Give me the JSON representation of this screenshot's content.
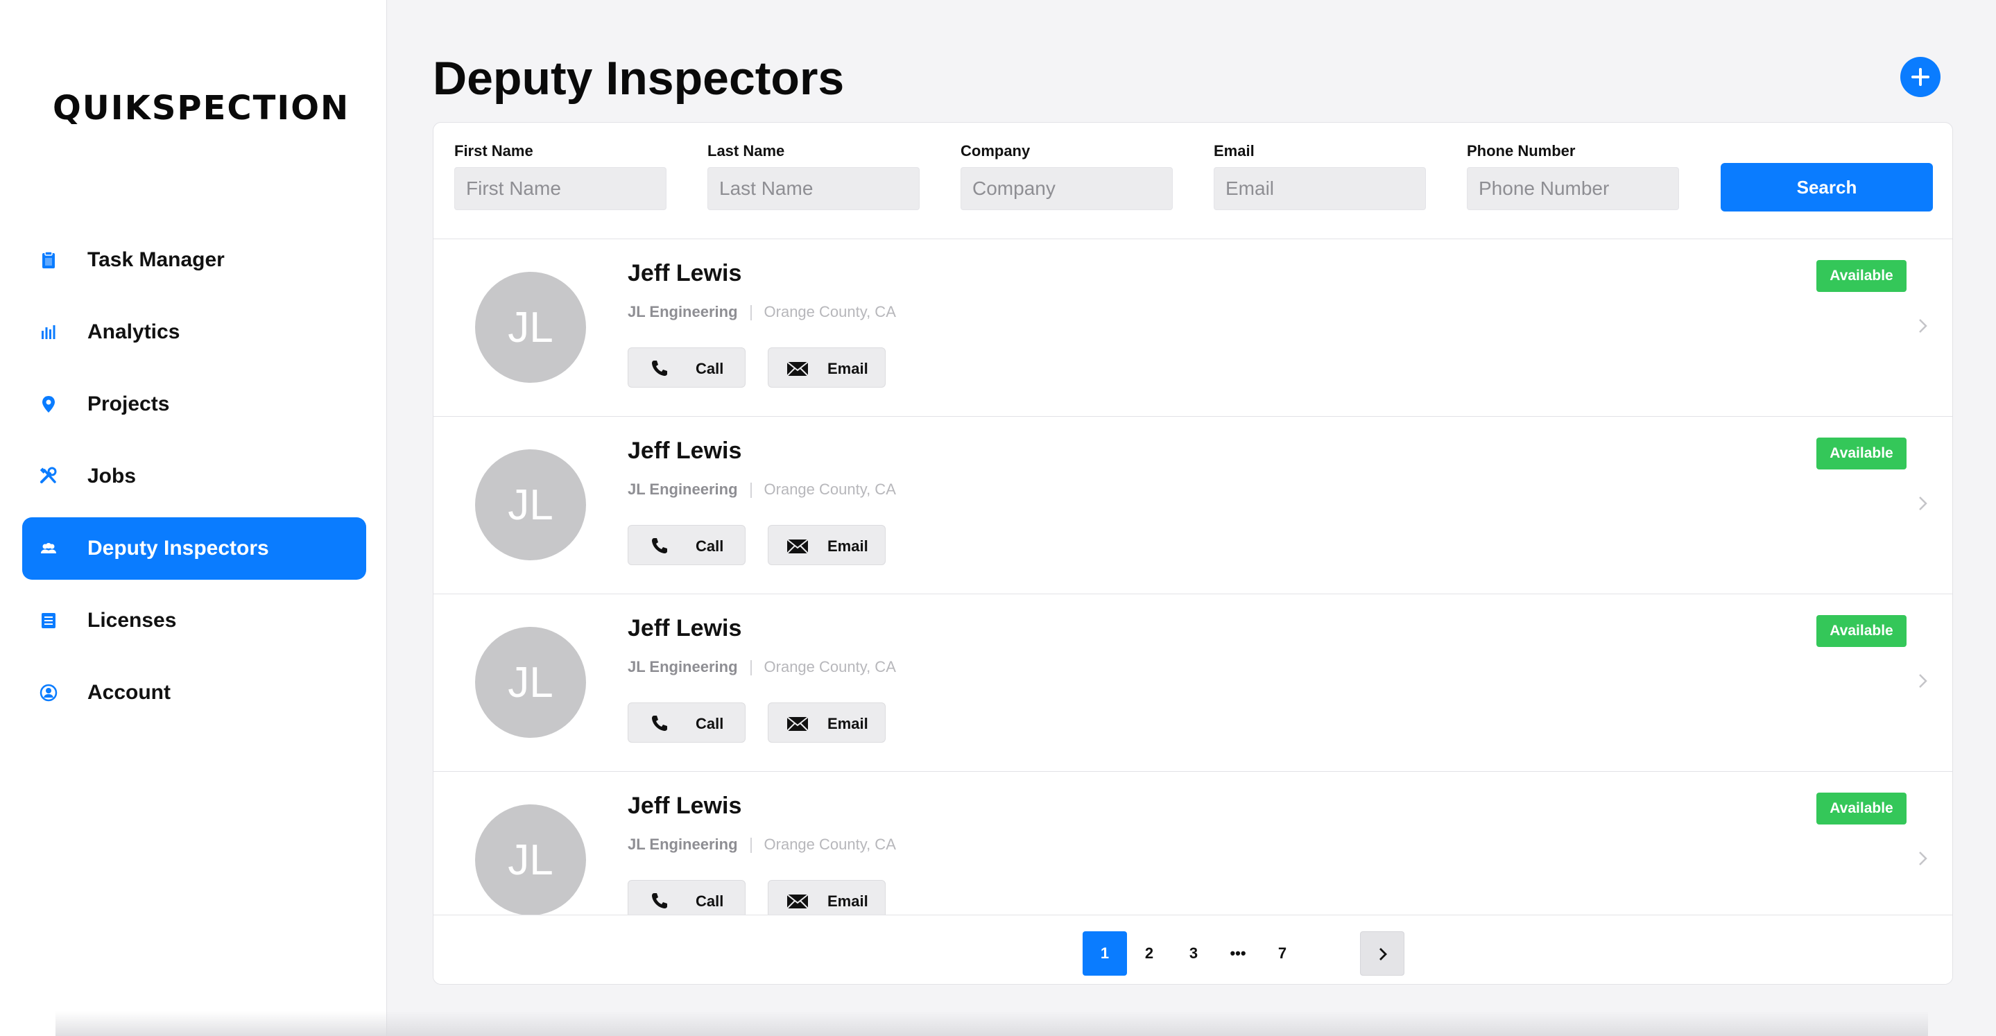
{
  "app": {
    "logo": "QUIKSPECTION",
    "accent": "#0a7cff",
    "status_color": "#34c759"
  },
  "sidebar": {
    "items": [
      {
        "label": "Task Manager",
        "icon": "clipboard-icon",
        "active": false
      },
      {
        "label": "Analytics",
        "icon": "bar-chart-icon",
        "active": false
      },
      {
        "label": "Projects",
        "icon": "map-pin-icon",
        "active": false
      },
      {
        "label": "Jobs",
        "icon": "tools-icon",
        "active": false
      },
      {
        "label": "Deputy Inspectors",
        "icon": "people-icon",
        "active": true
      },
      {
        "label": "Licenses",
        "icon": "document-list-icon",
        "active": false
      },
      {
        "label": "Account",
        "icon": "user-circle-icon",
        "active": false
      }
    ]
  },
  "header": {
    "title": "Deputy Inspectors",
    "add_icon": "plus-circle-icon"
  },
  "filters": {
    "first_name": {
      "label": "First Name",
      "placeholder": "First Name",
      "value": ""
    },
    "last_name": {
      "label": "Last Name",
      "placeholder": "Last Name",
      "value": ""
    },
    "company": {
      "label": "Company",
      "placeholder": "Company",
      "value": ""
    },
    "email": {
      "label": "Email",
      "placeholder": "Email",
      "value": ""
    },
    "phone": {
      "label": "Phone Number",
      "placeholder": "Phone Number",
      "value": ""
    },
    "search_label": "Search"
  },
  "inspectors": [
    {
      "initials": "JL",
      "name": "Jeff Lewis",
      "company": "JL Engineering",
      "location": "Orange County, CA",
      "status": "Available",
      "call_label": "Call",
      "email_label": "Email"
    },
    {
      "initials": "JL",
      "name": "Jeff Lewis",
      "company": "JL Engineering",
      "location": "Orange County, CA",
      "status": "Available",
      "call_label": "Call",
      "email_label": "Email"
    },
    {
      "initials": "JL",
      "name": "Jeff Lewis",
      "company": "JL Engineering",
      "location": "Orange County, CA",
      "status": "Available",
      "call_label": "Call",
      "email_label": "Email"
    },
    {
      "initials": "JL",
      "name": "Jeff Lewis",
      "company": "JL Engineering",
      "location": "Orange County, CA",
      "status": "Available",
      "call_label": "Call",
      "email_label": "Email"
    }
  ],
  "pagination": {
    "pages": [
      "1",
      "2",
      "3",
      "•••",
      "7"
    ],
    "current": "1",
    "next_icon": "chevron-right-icon"
  }
}
